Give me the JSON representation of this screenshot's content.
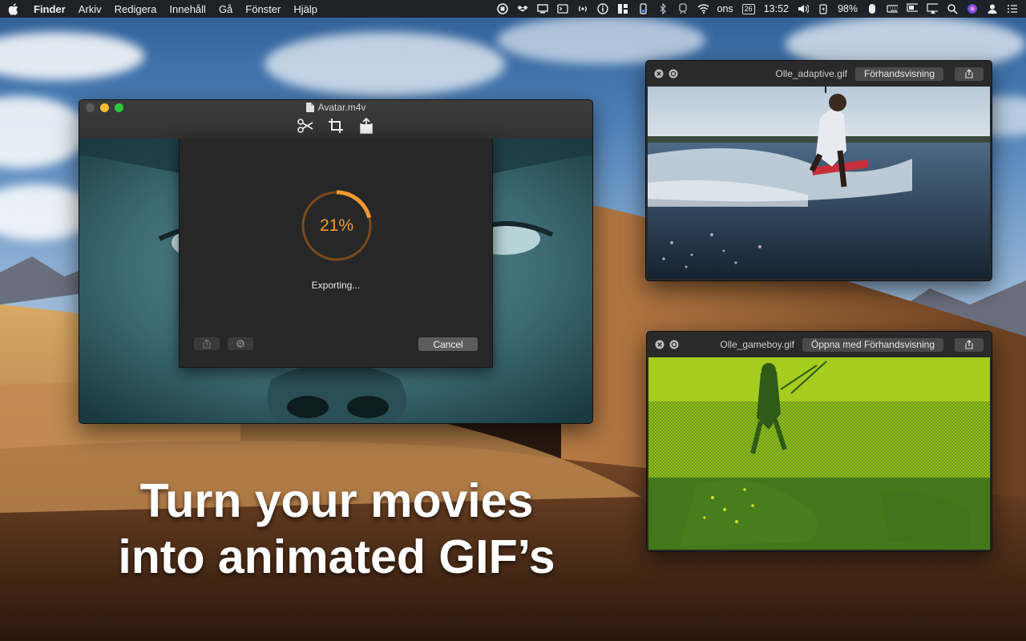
{
  "menubar": {
    "app_name": "Finder",
    "items": [
      "Arkiv",
      "Redigera",
      "Innehåll",
      "Gå",
      "Fönster",
      "Hjälp"
    ],
    "day": "ons",
    "date": "26",
    "time": "13:52",
    "battery": "98%"
  },
  "main_window": {
    "title": "Avatar.m4v",
    "export_sheet": {
      "progress": 21,
      "progress_label": "21%",
      "status": "Exporting...",
      "cancel_label": "Cancel"
    }
  },
  "preview_adaptive": {
    "filename": "Olle_adaptive.gif",
    "open_label": "Förhandsvisning"
  },
  "preview_gameboy": {
    "filename": "Olle_gameboy.gif",
    "open_label": "Öppna med Förhandsvisning"
  },
  "tagline": {
    "line1": "Turn your movies",
    "line2": "into animated GIF’s"
  },
  "colors": {
    "progress_accent": "#f29a31",
    "traffic_min": "#f6be2f",
    "traffic_max": "#2fc840"
  }
}
